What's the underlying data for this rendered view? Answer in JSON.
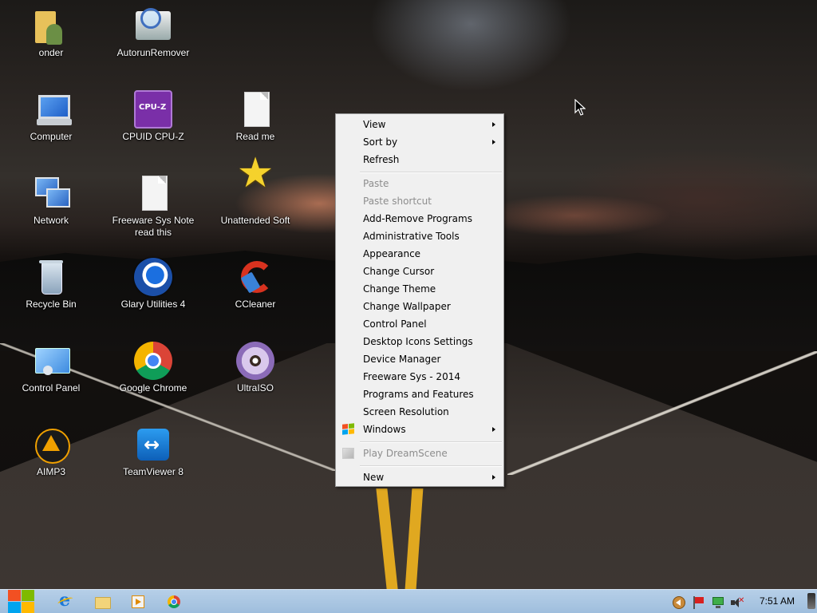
{
  "desktop": {
    "icons": [
      {
        "label": "onder",
        "icon": "user-folder-icon"
      },
      {
        "label": "AutorunRemover",
        "icon": "autorun-remover-icon"
      },
      {
        "label": "Computer",
        "icon": "computer-icon"
      },
      {
        "label": "CPUID CPU-Z",
        "icon": "cpu-z-icon"
      },
      {
        "label": "Read me",
        "icon": "document-icon"
      },
      {
        "label": "Network",
        "icon": "network-icon"
      },
      {
        "label": "Freeware Sys Note read this",
        "icon": "document-icon"
      },
      {
        "label": "Unattended Soft",
        "icon": "star-icon"
      },
      {
        "label": "Recycle Bin",
        "icon": "recycle-bin-icon"
      },
      {
        "label": "Glary Utilities 4",
        "icon": "glary-utilities-icon"
      },
      {
        "label": "CCleaner",
        "icon": "ccleaner-icon"
      },
      {
        "label": "Control Panel",
        "icon": "control-panel-icon"
      },
      {
        "label": "Google Chrome",
        "icon": "chrome-icon"
      },
      {
        "label": "UltraISO",
        "icon": "ultraiso-icon"
      },
      {
        "label": "AIMP3",
        "icon": "aimp-icon"
      },
      {
        "label": "TeamViewer 8",
        "icon": "teamviewer-icon"
      }
    ]
  },
  "context_menu": {
    "items": [
      {
        "label": "View",
        "submenu": true,
        "enabled": true
      },
      {
        "label": "Sort by",
        "submenu": true,
        "enabled": true
      },
      {
        "label": "Refresh",
        "submenu": false,
        "enabled": true
      },
      {
        "label": "Paste",
        "submenu": false,
        "enabled": false
      },
      {
        "label": "Paste shortcut",
        "submenu": false,
        "enabled": false
      },
      {
        "label": "Add-Remove Programs",
        "submenu": false,
        "enabled": true
      },
      {
        "label": "Administrative Tools",
        "submenu": false,
        "enabled": true
      },
      {
        "label": "Appearance",
        "submenu": false,
        "enabled": true
      },
      {
        "label": "Change Cursor",
        "submenu": false,
        "enabled": true
      },
      {
        "label": "Change Theme",
        "submenu": false,
        "enabled": true
      },
      {
        "label": "Change Wallpaper",
        "submenu": false,
        "enabled": true
      },
      {
        "label": "Control Panel",
        "submenu": false,
        "enabled": true
      },
      {
        "label": "Desktop Icons Settings",
        "submenu": false,
        "enabled": true
      },
      {
        "label": "Device Manager",
        "submenu": false,
        "enabled": true
      },
      {
        "label": "Freeware Sys - 2014",
        "submenu": false,
        "enabled": true
      },
      {
        "label": "Programs and Features",
        "submenu": false,
        "enabled": true
      },
      {
        "label": "Screen Resolution",
        "submenu": false,
        "enabled": true
      },
      {
        "label": "Windows",
        "submenu": true,
        "enabled": true,
        "icon": "windows-flag-icon"
      },
      {
        "label": "Play DreamScene",
        "submenu": false,
        "enabled": false,
        "icon": "dreamscene-icon"
      },
      {
        "label": "New",
        "submenu": true,
        "enabled": true
      }
    ]
  },
  "taskbar": {
    "start_icon": "windows-logo-icon",
    "pinned": [
      {
        "name": "Internet Explorer",
        "icon": "internet-explorer-icon"
      },
      {
        "name": "File Explorer",
        "icon": "folder-icon"
      },
      {
        "name": "Media Player",
        "icon": "media-player-icon"
      },
      {
        "name": "Google Chrome",
        "icon": "chrome-icon"
      }
    ],
    "tray": {
      "icons": [
        "back-arrow-icon",
        "action-center-flag-icon",
        "network-icon",
        "volume-muted-icon"
      ],
      "mute_mark": "✕",
      "clock": "7:51 AM"
    }
  },
  "colors": {
    "taskbar": "#a8c4e2",
    "menu_background": "#f0f0f0",
    "menu_disabled_text": "#8d8d8d"
  }
}
